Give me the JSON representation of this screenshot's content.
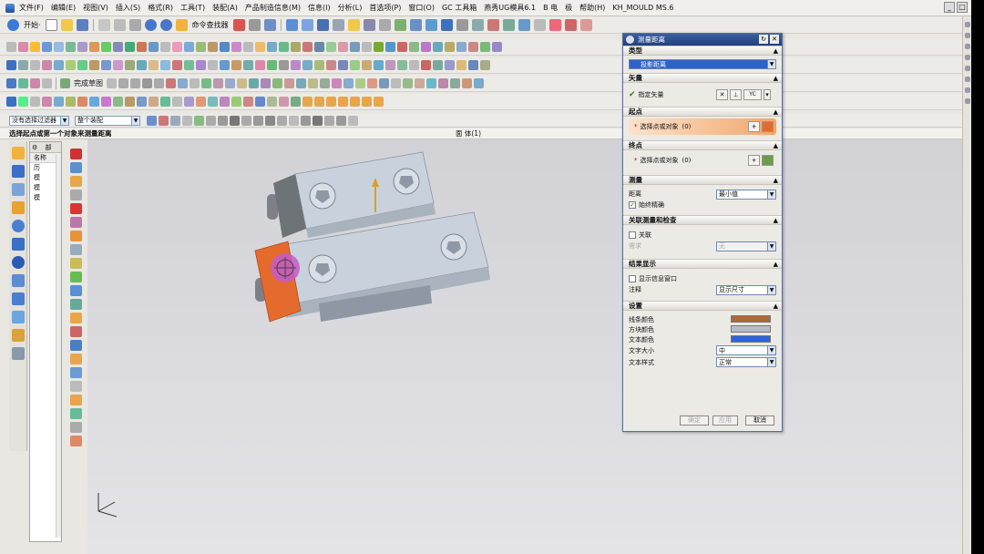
{
  "menu": {
    "items": [
      "文件(F)",
      "编辑(E)",
      "视图(V)",
      "插入(S)",
      "格式(R)",
      "工具(T)",
      "装配(A)",
      "产品制造信息(M)",
      "信息(I)",
      "分析(L)",
      "首选项(P)",
      "窗口(O)",
      "GC 工具箱",
      "燕秀UG模具6.1",
      "B 电",
      "极",
      "帮助(H)",
      "KH_MOULD MS.6"
    ]
  },
  "toolbar1": {
    "start_label": "开始·",
    "command_finder_label": "命令查找器"
  },
  "toolbar4": {
    "sketch_label": "完成草图"
  },
  "selection": {
    "filter_value": "没有选择过滤器",
    "scope_value": "整个装配"
  },
  "status": {
    "prompt": "选择起点或第一个对象来测量距离",
    "view_info": "面 体(1)"
  },
  "nav": {
    "tabs": [
      "⚙",
      "部"
    ],
    "header": "名称",
    "rows": [
      "历",
      "模",
      "模",
      "模"
    ]
  },
  "dialog": {
    "title": "测量距离",
    "type": {
      "header": "类型",
      "value": "投影距离"
    },
    "vector": {
      "header": "矢量",
      "label": "指定矢量",
      "axis_label": "YC"
    },
    "start": {
      "header": "起点",
      "pick_label": "选择点或对象",
      "count": "(0)"
    },
    "end": {
      "header": "终点",
      "pick_label": "选择点或对象",
      "count": "(0)"
    },
    "measure": {
      "header": "测量",
      "distance_label": "距离",
      "distance_value": "最小值",
      "always_exact_label": "始终精确"
    },
    "assoc": {
      "header": "关联测量和检查",
      "assoc_label": "关联",
      "req_label": "需求",
      "req_value": "无"
    },
    "results": {
      "header": "结果显示",
      "show_window_label": "显示信息窗口",
      "annotation_label": "注释",
      "annotation_value": "显示尺寸"
    },
    "settings": {
      "header": "设置",
      "line_color_label": "线条颜色",
      "block_color_label": "方块颜色",
      "text_color_label": "文本颜色",
      "text_size_label": "文字大小",
      "text_size_value": "中",
      "text_style_label": "文本样式",
      "text_style_value": "正常",
      "line_color": "#a86b3a",
      "block_color": "#b8bcc8",
      "text_color": "#2f63d6"
    },
    "buttons": {
      "ok": "确定",
      "apply": "应用",
      "cancel": "取消"
    }
  }
}
